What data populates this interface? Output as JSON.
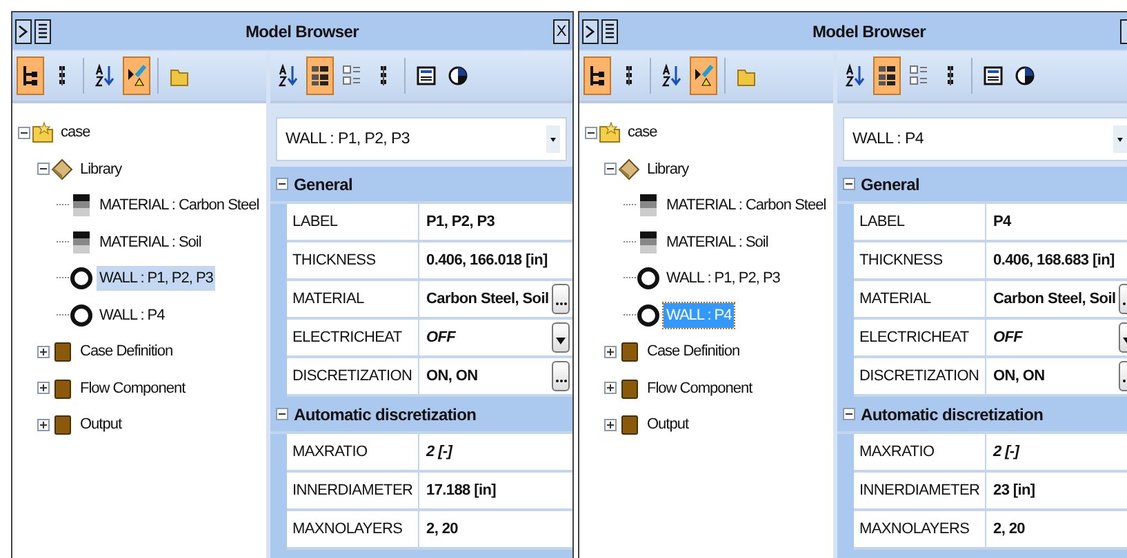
{
  "panels": [
    {
      "title": "Model Browser",
      "close_label": "X",
      "tree_focused": false,
      "tree_tools": [
        [
          {
            "kind": "hierarchy",
            "selected": true
          },
          {
            "kind": "flat",
            "selected": false
          }
        ],
        [
          {
            "kind": "sort",
            "selected": false
          },
          {
            "kind": "filter",
            "selected": true
          }
        ],
        [
          {
            "kind": "folder",
            "selected": false
          }
        ]
      ],
      "prop_tools": [
        [
          {
            "kind": "sort",
            "selected": false
          },
          {
            "kind": "categorized",
            "selected": true
          },
          {
            "kind": "expand",
            "selected": false
          },
          {
            "kind": "flat",
            "selected": false
          }
        ],
        [
          {
            "kind": "view",
            "selected": false
          },
          {
            "kind": "pie",
            "selected": false
          }
        ]
      ],
      "tree": [
        {
          "label": "case",
          "kind": "case",
          "expanded": true,
          "selected": false,
          "children": [
            {
              "label": "Library",
              "kind": "library",
              "expanded": true,
              "selected": false,
              "children": [
                {
                  "label": "MATERIAL : Carbon Steel",
                  "kind": "material",
                  "selected": false
                },
                {
                  "label": "MATERIAL : Soil",
                  "kind": "material",
                  "selected": false
                },
                {
                  "label": "WALL : P1, P2, P3",
                  "kind": "wall",
                  "selected": true
                },
                {
                  "label": "WALL : P4",
                  "kind": "wall",
                  "selected": false
                }
              ]
            },
            {
              "label": "Case Definition",
              "kind": "folder",
              "expanded": false,
              "selected": false
            },
            {
              "label": "Flow Component",
              "kind": "folder",
              "expanded": false,
              "selected": false
            },
            {
              "label": "Output",
              "kind": "folder",
              "expanded": false,
              "selected": false
            }
          ]
        }
      ],
      "combo": {
        "value": "WALL : P1, P2, P3"
      },
      "categories": [
        {
          "title": "General",
          "expanded": true,
          "rows": [
            {
              "name": "LABEL",
              "value": "P1, P2, P3",
              "kind": "text",
              "italic": false
            },
            {
              "name": "THICKNESS",
              "value": "0.406, 166.018 [in]",
              "kind": "text",
              "italic": false
            },
            {
              "name": "MATERIAL",
              "value": "Carbon Steel, Soil",
              "kind": "ellipsis",
              "italic": false
            },
            {
              "name": "ELECTRICHEAT",
              "value": "OFF",
              "kind": "dropdown",
              "italic": true
            },
            {
              "name": "DISCRETIZATION",
              "value": "ON, ON",
              "kind": "ellipsis",
              "italic": false
            }
          ]
        },
        {
          "title": "Automatic discretization",
          "expanded": true,
          "rows": [
            {
              "name": "MAXRATIO",
              "value": "2 [-]",
              "kind": "text",
              "italic": true
            },
            {
              "name": "INNERDIAMETER",
              "value": "17.188 [in]",
              "kind": "text",
              "italic": false
            },
            {
              "name": "MAXNOLAYERS",
              "value": "2, 20",
              "kind": "text",
              "italic": false
            }
          ]
        }
      ]
    },
    {
      "title": "Model Browser",
      "tree_focused": true,
      "tree_tools": [
        [
          {
            "kind": "hierarchy",
            "selected": true
          },
          {
            "kind": "flat",
            "selected": false
          }
        ],
        [
          {
            "kind": "sort",
            "selected": false
          },
          {
            "kind": "filter",
            "selected": true
          }
        ],
        [
          {
            "kind": "folder",
            "selected": false
          }
        ]
      ],
      "prop_tools": [
        [
          {
            "kind": "sort",
            "selected": false
          },
          {
            "kind": "categorized",
            "selected": true
          },
          {
            "kind": "expand",
            "selected": false
          },
          {
            "kind": "flat",
            "selected": false
          }
        ],
        [
          {
            "kind": "view",
            "selected": false
          },
          {
            "kind": "pie",
            "selected": false
          }
        ]
      ],
      "tree": [
        {
          "label": "case",
          "kind": "case",
          "expanded": true,
          "selected": false,
          "children": [
            {
              "label": "Library",
              "kind": "library",
              "expanded": true,
              "selected": false,
              "children": [
                {
                  "label": "MATERIAL : Carbon Steel",
                  "kind": "material",
                  "selected": false
                },
                {
                  "label": "MATERIAL : Soil",
                  "kind": "material",
                  "selected": false
                },
                {
                  "label": "WALL : P1, P2, P3",
                  "kind": "wall",
                  "selected": false
                },
                {
                  "label": "WALL : P4",
                  "kind": "wall",
                  "selected": true
                }
              ]
            },
            {
              "label": "Case Definition",
              "kind": "folder",
              "expanded": false,
              "selected": false
            },
            {
              "label": "Flow Component",
              "kind": "folder",
              "expanded": false,
              "selected": false
            },
            {
              "label": "Output",
              "kind": "folder",
              "expanded": false,
              "selected": false
            }
          ]
        }
      ],
      "combo": {
        "value": "WALL : P4"
      },
      "categories": [
        {
          "title": "General",
          "expanded": true,
          "rows": [
            {
              "name": "LABEL",
              "value": "P4",
              "kind": "text",
              "italic": false
            },
            {
              "name": "THICKNESS",
              "value": "0.406, 168.683 [in]",
              "kind": "text",
              "italic": false
            },
            {
              "name": "MATERIAL",
              "value": "Carbon Steel, Soil",
              "kind": "ellipsis",
              "italic": false
            },
            {
              "name": "ELECTRICHEAT",
              "value": "OFF",
              "kind": "dropdown",
              "italic": true
            },
            {
              "name": "DISCRETIZATION",
              "value": "ON, ON",
              "kind": "ellipsis",
              "italic": false
            }
          ]
        },
        {
          "title": "Automatic discretization",
          "expanded": true,
          "rows": [
            {
              "name": "MAXRATIO",
              "value": "2 [-]",
              "kind": "text",
              "italic": true
            },
            {
              "name": "INNERDIAMETER",
              "value": "23 [in]",
              "kind": "text",
              "italic": false
            },
            {
              "name": "MAXNOLAYERS",
              "value": "2, 20",
              "kind": "text",
              "italic": false
            }
          ]
        }
      ]
    }
  ]
}
